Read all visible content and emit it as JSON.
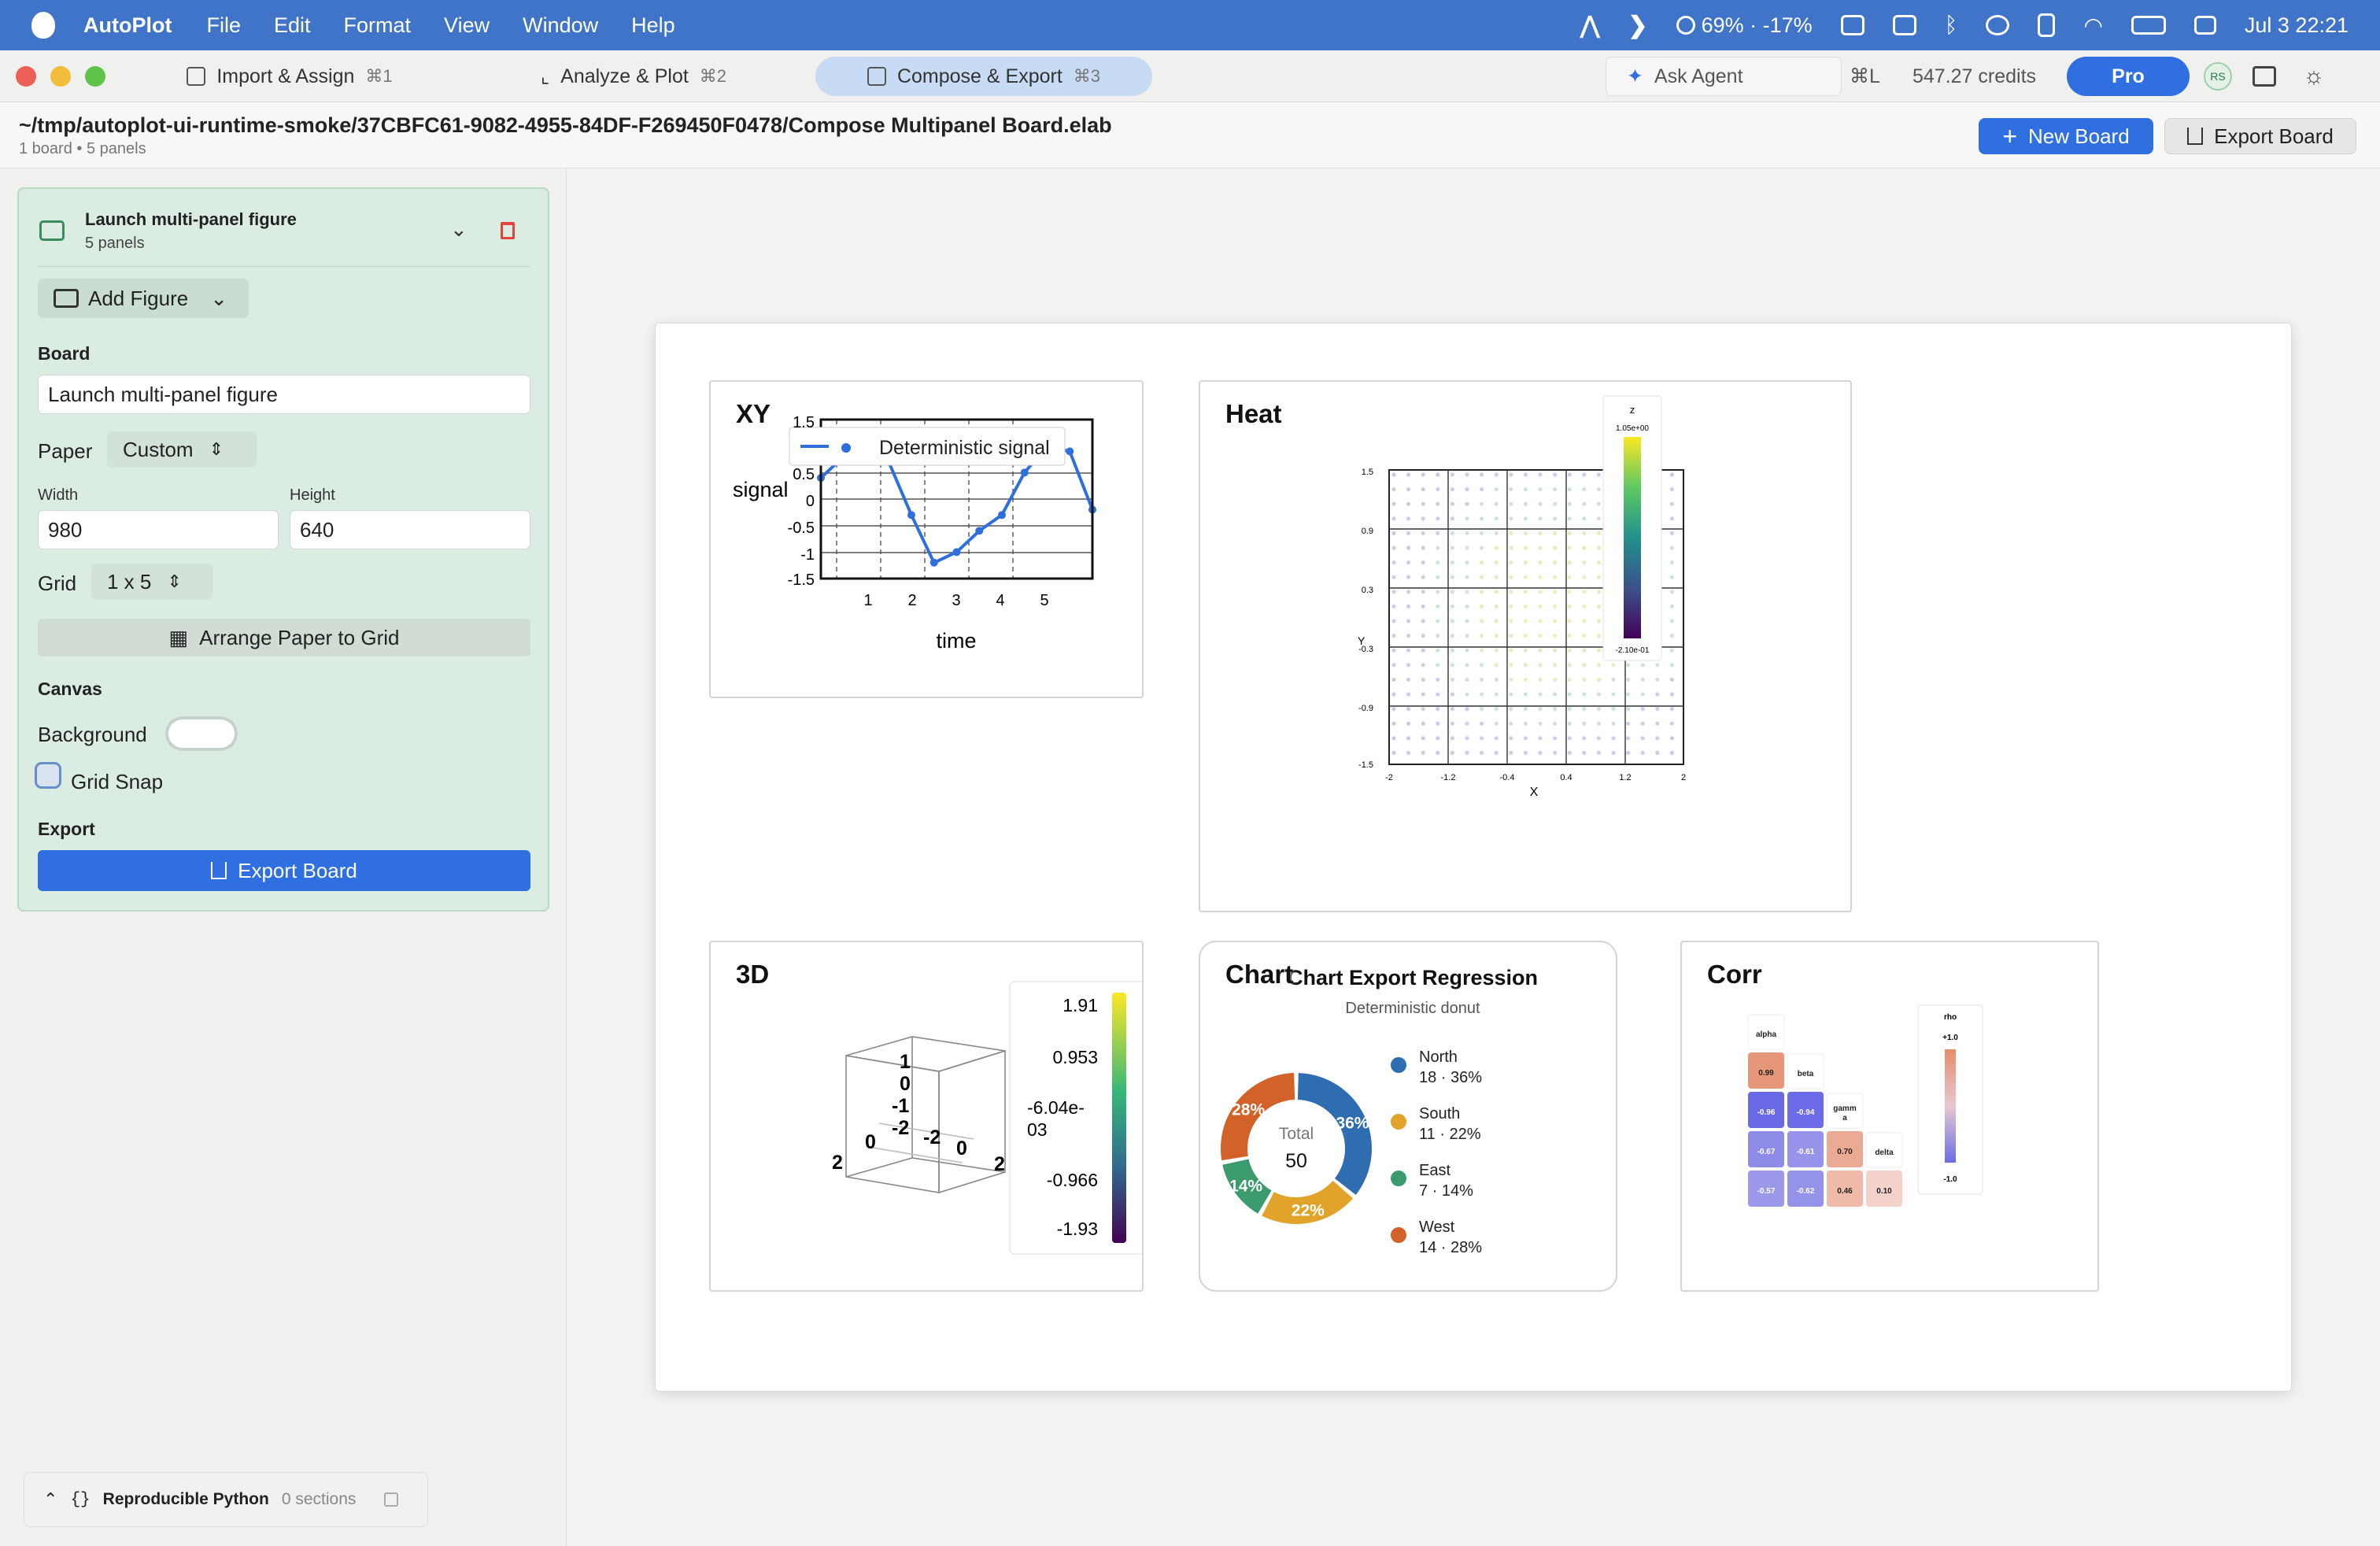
{
  "menubar": {
    "app_name": "AutoPlot",
    "menus": [
      "File",
      "Edit",
      "Format",
      "View",
      "Window",
      "Help"
    ],
    "battery": "69% · -17%",
    "datetime": "Jul 3  22:21"
  },
  "tabs": [
    {
      "label": "Import & Assign",
      "shortcut": "⌘1"
    },
    {
      "label": "Analyze & Plot",
      "shortcut": "⌘2"
    },
    {
      "label": "Compose & Export",
      "shortcut": "⌘3"
    }
  ],
  "toolbar": {
    "ask_agent": "Ask Agent",
    "ask_shortcut": "⌘L",
    "credits": "547.27 credits",
    "pro": "Pro",
    "avatar": "RS",
    "new_board": "New Board",
    "export_board": "Export Board"
  },
  "document": {
    "path": "~/tmp/autoplot-ui-runtime-smoke/37CBFC61-9082-4955-84DF-F269450F0478/Compose Multipanel Board.elab",
    "summary": "1 board • 5 panels"
  },
  "sidebar": {
    "figure_title": "Launch multi-panel figure",
    "figure_panels": "5 panels",
    "add_figure": "Add Figure",
    "board_label": "Board",
    "board_name": "Launch multi-panel figure",
    "paper_label": "Paper",
    "paper_value": "Custom",
    "width_label": "Width",
    "width_value": "980",
    "height_label": "Height",
    "height_value": "640",
    "grid_label": "Grid",
    "grid_value": "1 x 5",
    "arrange": "Arrange Paper to Grid",
    "canvas_label": "Canvas",
    "background_label": "Background",
    "grid_snap": "Grid Snap",
    "export_label": "Export",
    "export_board": "Export Board"
  },
  "python_bar": {
    "label": "Reproducible Python",
    "sections": "0 sections"
  },
  "colors": {
    "accent": "#2f6fe0",
    "menubar": "#3f74c8",
    "sidebar_card": "#dbece2",
    "delete": "#e0443a"
  },
  "panels": {
    "xy": {
      "title": "XY",
      "legend": "Deterministic signal",
      "xlabel": "time",
      "ylabel": "signal",
      "yticks": [
        "1.5",
        "0.5",
        "0",
        "-0.5",
        "-1",
        "-1.5"
      ],
      "xticks": [
        "1",
        "2",
        "3",
        "4",
        "5"
      ]
    },
    "heat": {
      "title": "Heat",
      "colorbar_label": "z",
      "colorbar_max": "1.05e+00",
      "colorbar_min": "-2.10e-01",
      "xlabel": "X",
      "ylabel": "Y",
      "yticks": [
        "1.5",
        "0.9",
        "0.3",
        "-0.3",
        "-0.9",
        "-1.5"
      ],
      "xticks": [
        "-2",
        "-1.2",
        "-0.4",
        "0.4",
        "1.2",
        "2"
      ]
    },
    "threed": {
      "title": "3D",
      "colorbar_ticks": [
        "1.91",
        "0.953",
        "-6.04e-",
        "03",
        "-0.966",
        "-1.93"
      ],
      "axis_labels": [
        "1",
        "0",
        "-1",
        "-2",
        "-2",
        "0",
        "2",
        "0",
        "2"
      ]
    },
    "chart": {
      "title": "Chart",
      "chart_title": "Chart Export Regression",
      "subtitle": "Deterministic donut",
      "center_label": "Total",
      "center_value": "50"
    },
    "corr": {
      "title": "Corr",
      "legend_title": "rho",
      "legend_max": "+1.0",
      "legend_min": "-1.0",
      "variables": [
        "alpha",
        "beta",
        "gamm a",
        "delta"
      ],
      "cells": [
        "0.99",
        "-0.96",
        "-0.94",
        "-0.67",
        "-0.61",
        "0.70",
        "-0.57",
        "-0.62",
        "0.46",
        "0.10"
      ]
    }
  },
  "chart_data": [
    {
      "type": "line",
      "title": "XY",
      "xlabel": "time",
      "ylabel": "signal",
      "series": [
        {
          "name": "Deterministic signal",
          "x": [
            0.0,
            0.5,
            1.0,
            1.5,
            2.0,
            2.5,
            3.0,
            3.5,
            4.0,
            4.5,
            5.0,
            5.5,
            6.0
          ],
          "y": [
            0.4,
            0.8,
            1.0,
            0.7,
            -0.3,
            -1.2,
            -1.0,
            -0.6,
            -0.3,
            0.5,
            1.0,
            0.9,
            -0.2
          ]
        }
      ],
      "xlim": [
        0,
        6
      ],
      "ylim": [
        -1.5,
        1.5
      ]
    },
    {
      "type": "pie",
      "title": "Chart Export Regression",
      "subtitle": "Deterministic donut",
      "categories": [
        "North",
        "South",
        "East",
        "West"
      ],
      "values": [
        18,
        11,
        7,
        14
      ],
      "percent_labels": [
        "36%",
        "22%",
        "14%",
        "28%"
      ],
      "value_labels": [
        "18 · 36%",
        "11 · 22%",
        "7 · 14%",
        "14 · 28%"
      ],
      "colors": [
        "#2f6db0",
        "#e1a32a",
        "#3b9a6e",
        "#d3622a"
      ]
    },
    {
      "type": "heatmap",
      "title": "Corr",
      "categories": [
        "alpha",
        "beta",
        "gamma",
        "delta"
      ],
      "values": [
        [
          0.99
        ],
        [
          -0.96,
          -0.94
        ],
        [
          -0.67,
          -0.61,
          0.7
        ],
        [
          -0.57,
          -0.62,
          0.46,
          0.1
        ]
      ],
      "ylim": [
        -1.0,
        1.0
      ]
    }
  ]
}
